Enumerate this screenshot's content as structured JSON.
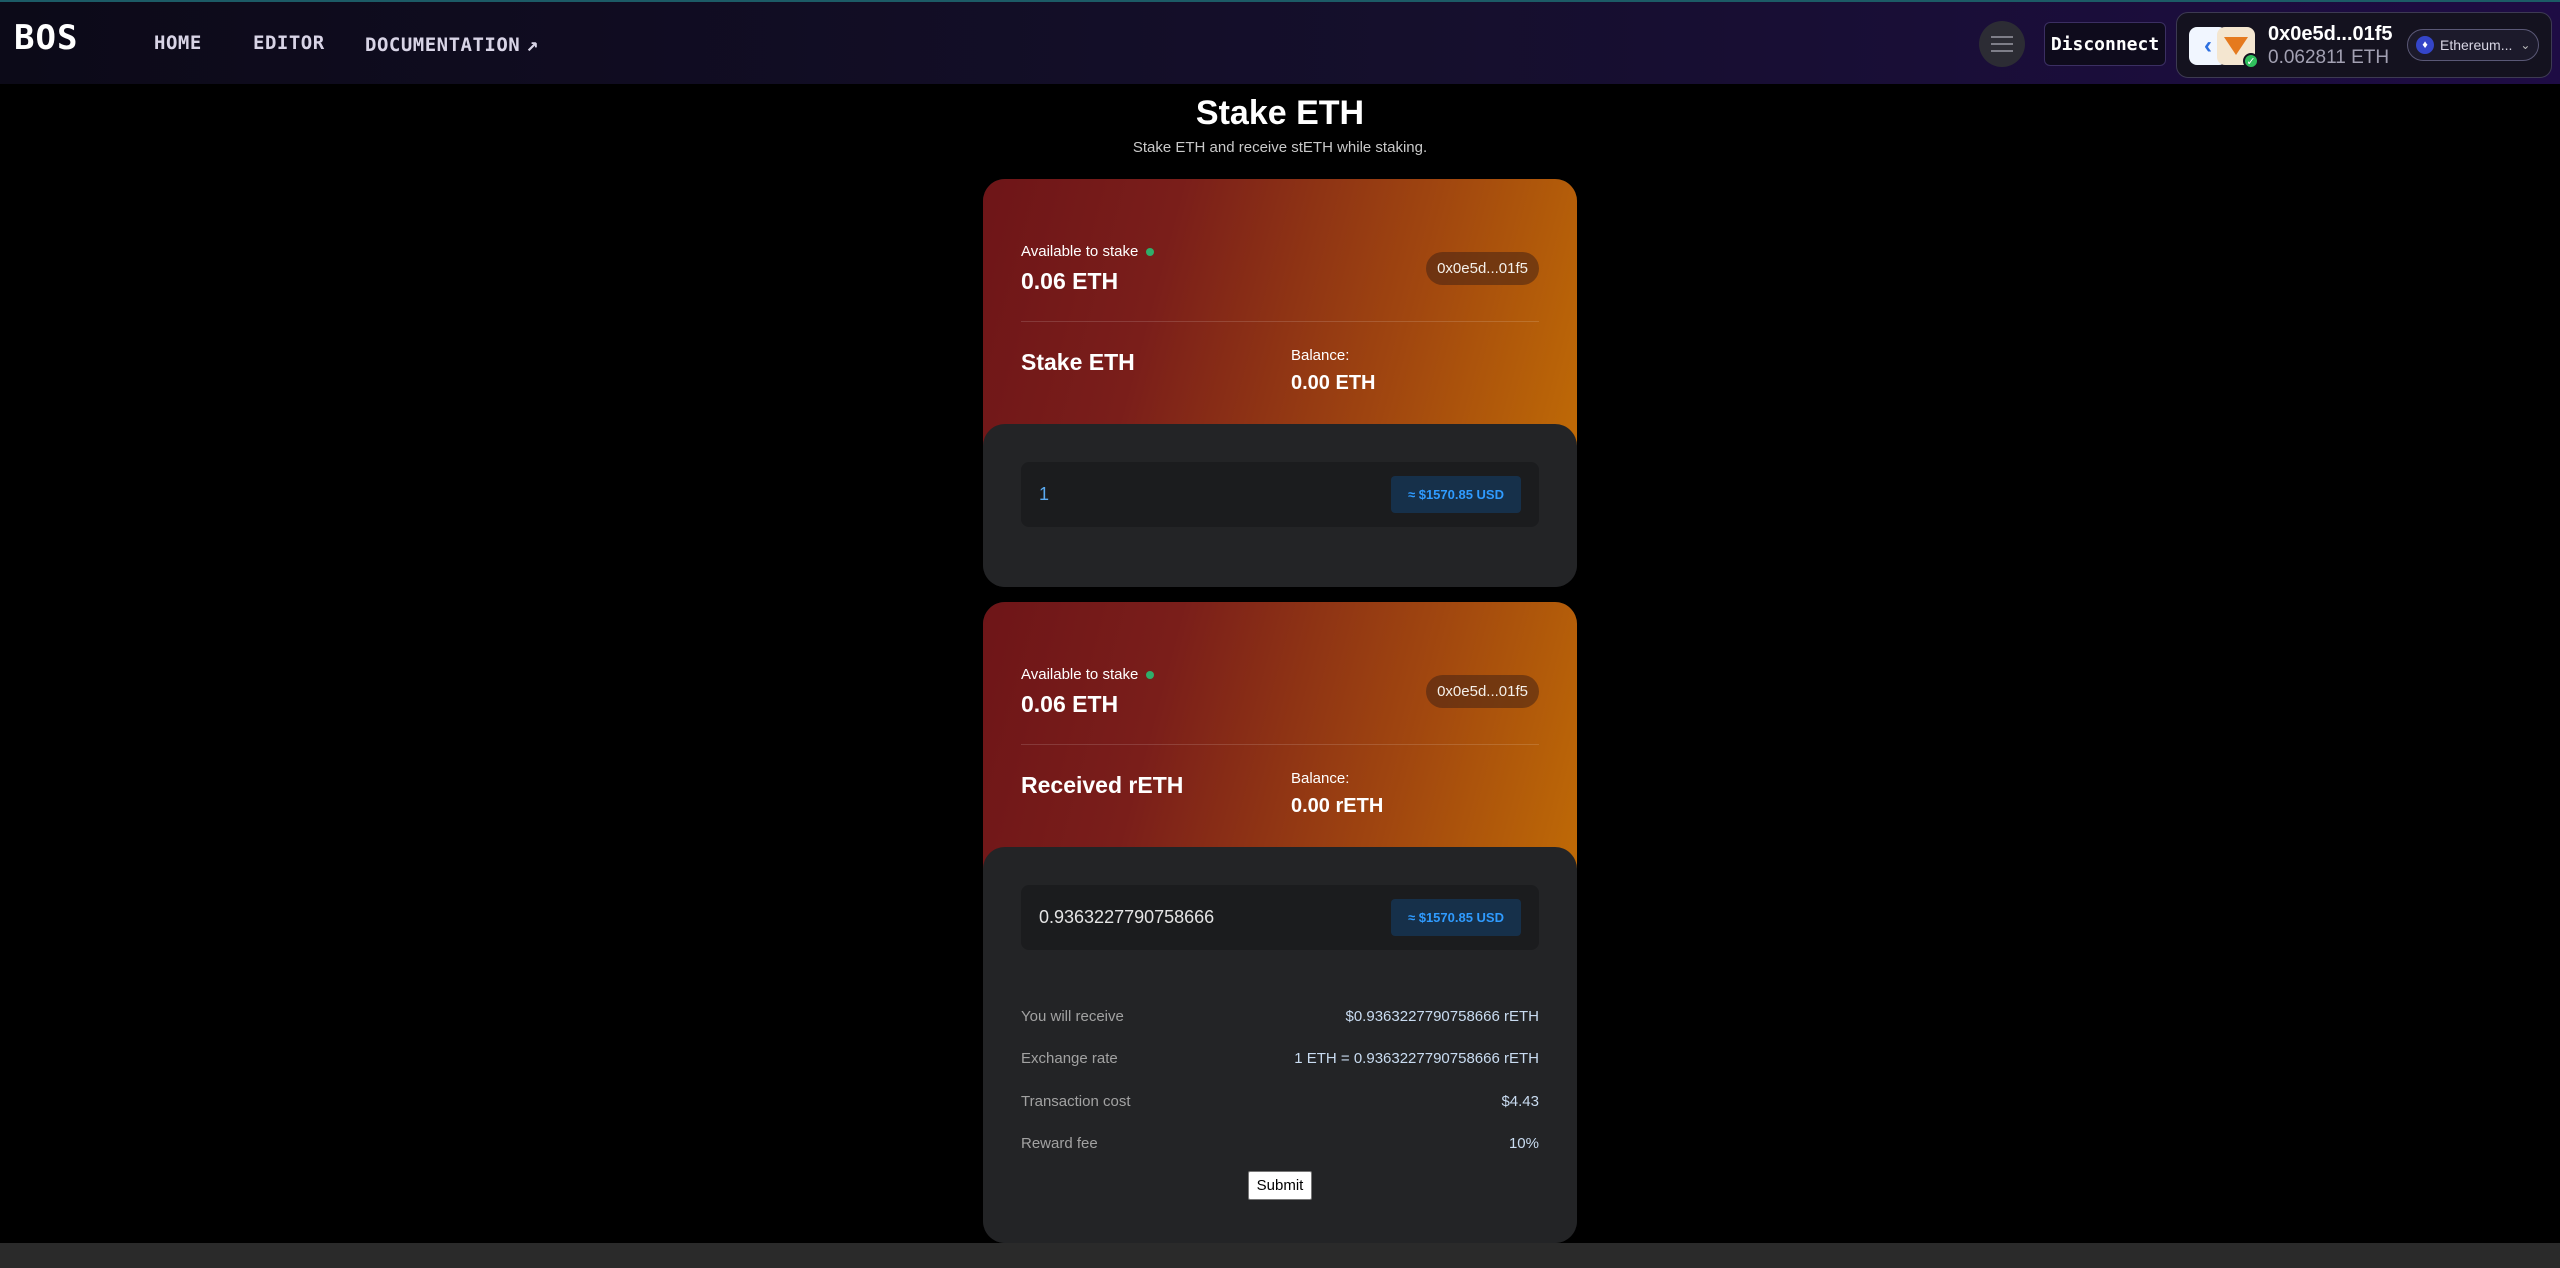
{
  "nav": {
    "logo": "BOS",
    "links": {
      "home": "HOME",
      "editor": "EDITOR",
      "documentation": "DOCUMENTATION",
      "documentation_icon": "↗"
    },
    "disconnect": "Disconnect",
    "wallet": {
      "address": "0x0e5d...01f5",
      "balance": "0.062811 ETH",
      "network": "Ethereum..."
    }
  },
  "page": {
    "title": "Stake ETH",
    "subtitle": "Stake ETH and receive stETH while staking."
  },
  "stake_card": {
    "available_label": "Available to stake",
    "available_value": "0.06 ETH",
    "address_pill": "0x0e5d...01f5",
    "section_title": "Stake ETH",
    "balance_label": "Balance:",
    "balance_value": "0.00 ETH",
    "input_value": "1",
    "usd_value": "≈ $1570.85 USD"
  },
  "receive_card": {
    "available_label": "Available to stake",
    "available_value": "0.06 ETH",
    "address_pill": "0x0e5d...01f5",
    "section_title": "Received rETH",
    "balance_label": "Balance:",
    "balance_value": "0.00 rETH",
    "input_value": "0.9363227790758666",
    "usd_value": "≈ $1570.85 USD",
    "details": {
      "receive_label": "You will receive",
      "receive_value": "$0.9363227790758666 rETH",
      "rate_label": "Exchange rate",
      "rate_value": "1 ETH = 0.9363227790758666 rETH",
      "cost_label": "Transaction cost",
      "cost_value": "$4.43",
      "fee_label": "Reward fee",
      "fee_value": "10%"
    },
    "submit_label": "Submit"
  },
  "colors": {
    "accent_red": "#6e1518",
    "accent_orange": "#bf6a06",
    "usd_blue": "#2f9bff",
    "status_green": "#2fae6a"
  },
  "icons": [
    "menu-icon",
    "external-link-icon",
    "wallet-connect-icon",
    "metamask-icon",
    "connected-check-icon",
    "ethereum-icon",
    "chevron-down-icon",
    "status-dot-icon"
  ]
}
